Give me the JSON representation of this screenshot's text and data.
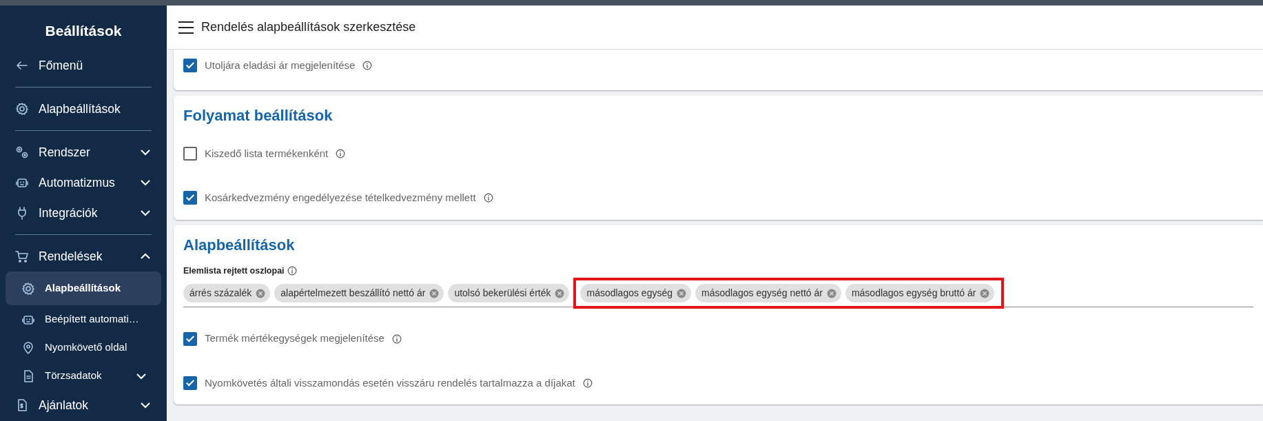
{
  "sidebar": {
    "title": "Beállítások",
    "items": [
      {
        "kind": "back",
        "label": "Főmenü"
      },
      {
        "kind": "divider"
      },
      {
        "kind": "item",
        "label": "Alapbeállítások"
      },
      {
        "kind": "divider"
      },
      {
        "kind": "group",
        "label": "Rendszer",
        "expanded": false
      },
      {
        "kind": "group",
        "label": "Automatizmus",
        "expanded": false
      },
      {
        "kind": "group",
        "label": "Integrációk",
        "expanded": false
      },
      {
        "kind": "divider"
      },
      {
        "kind": "group",
        "label": "Rendelések",
        "expanded": true,
        "children": [
          {
            "label": "Alapbeállítások",
            "selected": true
          },
          {
            "label": "Beépített automati…",
            "selected": false
          },
          {
            "label": "Nyomkövető oldal",
            "selected": false
          },
          {
            "label": "Törzsadatok",
            "selected": false,
            "expanded": false
          }
        ]
      },
      {
        "kind": "group",
        "label": "Ajánlatok",
        "expanded": false
      }
    ]
  },
  "header": {
    "title": "Rendelés alapbeállítások szerkesztése"
  },
  "sections": [
    {
      "options": [
        {
          "label": "Utoljára eladási ár megjelenítése",
          "checked": true
        }
      ]
    },
    {
      "title": "Folyamat beállítások",
      "options": [
        {
          "label": "Kiszedő lista termékenként",
          "checked": false
        },
        {
          "label": "Kosárkedvezmény engedélyezése tételkedvezmény mellett",
          "checked": true
        }
      ]
    },
    {
      "title": "Alapbeállítások",
      "tag_field": {
        "label": "Elemlista rejtett oszlopai",
        "tags": [
          {
            "text": "árrés százalék",
            "highlighted": false
          },
          {
            "text": "alapértelmezett beszállító nettó ár",
            "highlighted": false
          },
          {
            "text": "utolsó bekerülési érték",
            "highlighted": false
          },
          {
            "text": "másodlagos egység",
            "highlighted": true
          },
          {
            "text": "másodlagos egység nettó ár",
            "highlighted": true
          },
          {
            "text": "másodlagos egység bruttó ár",
            "highlighted": true
          }
        ]
      },
      "options": [
        {
          "label": "Termék mértékegységek megjelenítése",
          "checked": true
        },
        {
          "label": "Nyomkövetés általi visszamondás esetén visszáru rendelés tartalmazza a díjakat",
          "checked": true
        }
      ]
    }
  ]
}
